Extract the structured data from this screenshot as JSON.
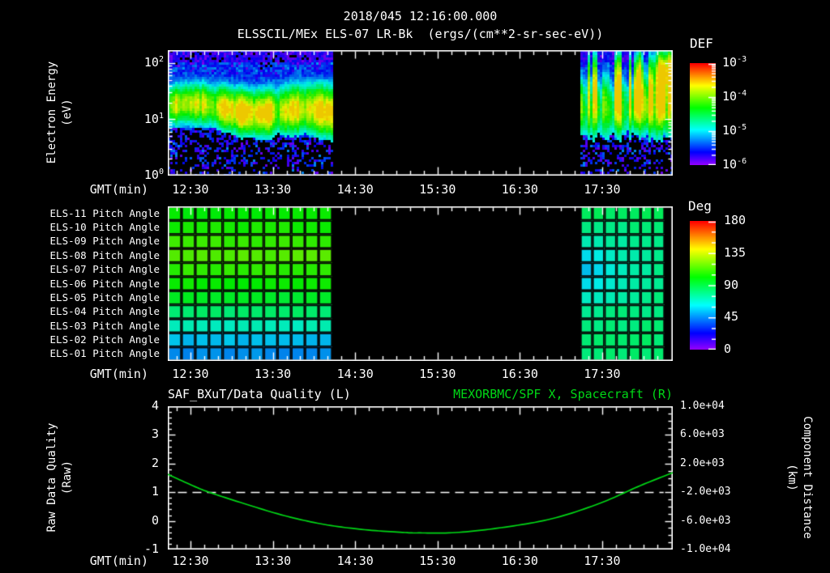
{
  "header": {
    "datetime": "2018/045 12:16:00.000",
    "title": "ELSSCIL/MEx ELS-07 LR-Bk  (ergs/(cm**2-sr-sec-eV))"
  },
  "time_axis": {
    "label": "GMT(min)",
    "tick_labels": [
      "12:30",
      "13:30",
      "14:30",
      "15:30",
      "16:30",
      "17:30"
    ],
    "tick_fracs": [
      0.0449,
      0.208,
      0.3711,
      0.5342,
      0.6972,
      0.8603
    ],
    "minor_frac": 0.02718
  },
  "colors": {
    "background": "#000000",
    "axis": "#ffffff",
    "text": "#ffffff",
    "series_green": "#00d816",
    "quality_dash": "#ffffff"
  },
  "chart_data": [
    {
      "type": "heatmap",
      "name": "electron_energy_spectrogram",
      "title": "ELSSCIL/MEx ELS-07 LR-Bk",
      "units": "ergs/(cm**2-sr-sec-eV)",
      "ylabel": [
        "Electron Energy",
        "(eV)"
      ],
      "yscale": "log",
      "ytick_base": "10",
      "ytick_exponents": [
        "2",
        "1",
        "0"
      ],
      "y_decades_span": 2.23,
      "colorbar": {
        "title": "DEF",
        "scale": "log",
        "tick_base": "10",
        "tick_exponents": [
          "-3",
          "-4",
          "-5",
          "-6"
        ]
      },
      "data_blocks": [
        {
          "start_frac": 0.0,
          "end_frac": 0.326,
          "style": "smooth",
          "band_center_log10_ev": 1.2,
          "band_sigma_decades": 0.34,
          "peak_log10_flux": -4.0
        },
        {
          "start_frac": 0.817,
          "end_frac": 1.0,
          "style": "streaky",
          "band_center_log10_ev": 1.35,
          "band_sigma_decades": 0.45,
          "peak_log10_flux": -3.9
        }
      ],
      "background_log10_flux": -5.7
    },
    {
      "type": "heatmap",
      "name": "pitch_angles",
      "unit": "Deg",
      "colorbar": {
        "title": "Deg",
        "ticks": [
          "180",
          "135",
          "90",
          "45",
          "0"
        ],
        "range": [
          0,
          180
        ]
      },
      "block1": {
        "start_frac": 0.0,
        "end_frac": 0.326,
        "cols": 12
      },
      "block2": {
        "start_frac": 0.817,
        "end_frac": 0.984,
        "cols": 7
      },
      "rows": [
        {
          "label": "ELS-11 Pitch Angle",
          "block1_deg": 102,
          "block2_deg": [
            88,
            87,
            86,
            86,
            87,
            86,
            88
          ]
        },
        {
          "label": "ELS-10 Pitch Angle",
          "block1_deg": 105,
          "block2_deg": [
            82,
            81,
            80,
            80,
            81,
            82,
            83
          ]
        },
        {
          "label": "ELS-09 Pitch Angle",
          "block1_deg": 111,
          "block2_deg": [
            72,
            74,
            75,
            76,
            77,
            78,
            79
          ]
        },
        {
          "label": "ELS-08 Pitch Angle",
          "block1_deg": 115,
          "block2_deg": [
            62,
            66,
            70,
            73,
            75,
            77,
            78
          ]
        },
        {
          "label": "ELS-07 Pitch Angle",
          "block1_deg": 109,
          "block2_deg": [
            56,
            60,
            66,
            71,
            74,
            76,
            78
          ]
        },
        {
          "label": "ELS-06 Pitch Angle",
          "block1_deg": 103,
          "block2_deg": [
            60,
            63,
            68,
            72,
            75,
            77,
            79
          ]
        },
        {
          "label": "ELS-05 Pitch Angle",
          "block1_deg": 95,
          "block2_deg": [
            68,
            70,
            72,
            75,
            77,
            79,
            80
          ]
        },
        {
          "label": "ELS-04 Pitch Angle",
          "block1_deg": 84,
          "block2_deg": [
            78,
            78,
            79,
            80,
            80,
            81,
            81
          ]
        },
        {
          "label": "ELS-03 Pitch Angle",
          "block1_deg": 71,
          "block2_deg": [
            80,
            80,
            81,
            81,
            82,
            82,
            82
          ]
        },
        {
          "label": "ELS-02 Pitch Angle",
          "block1_deg": 55,
          "block2_deg": [
            83,
            83,
            83,
            84,
            84,
            84,
            84
          ]
        },
        {
          "label": "ELS-01 Pitch Angle",
          "block1_deg": 47,
          "block2_deg": [
            82,
            82,
            82,
            83,
            83,
            83,
            83
          ]
        }
      ]
    },
    {
      "type": "line",
      "name": "quality_and_distance",
      "title_left": "SAF_BXuT/Data Quality (L)",
      "title_right": "MEXORBMC/SPF X, Spacecraft (R)",
      "ylabel_left": [
        "Raw Data Quality",
        "(Raw)"
      ],
      "ylabel_right": [
        "Component Distance",
        "(km)"
      ],
      "left_axis": {
        "ticks": [
          "4",
          "3",
          "2",
          "1",
          "0",
          "-1"
        ],
        "range": [
          4,
          -1
        ]
      },
      "right_axis": {
        "ticks": [
          "1.0e+04",
          "6.0e+03",
          "2.0e+03",
          "-2.0e+03",
          "-6.0e+03",
          "-1.0e+04"
        ],
        "range": [
          10000,
          -10000
        ]
      },
      "series": [
        {
          "name": "SAF_BXuT/Data Quality (L)",
          "axis": "left",
          "style": "dashed",
          "color": "#ffffff",
          "constant_value": 1,
          "start_frac": 0.02,
          "end_frac": 0.982
        },
        {
          "name": "MEXORBMC/SPF X, Spacecraft (R)",
          "axis": "right",
          "style": "solid",
          "color": "#00d816",
          "points_frac_km": [
            [
              0,
              500
            ],
            [
              0.05,
              -1100
            ],
            [
              0.082,
              -2000
            ],
            [
              0.15,
              -3560
            ],
            [
              0.23,
              -5250
            ],
            [
              0.31,
              -6500
            ],
            [
              0.39,
              -7230
            ],
            [
              0.47,
              -7630
            ],
            [
              0.5,
              -7680
            ],
            [
              0.57,
              -7630
            ],
            [
              0.66,
              -6950
            ],
            [
              0.76,
              -5710
            ],
            [
              0.855,
              -3560
            ],
            [
              0.936,
              -1070
            ],
            [
              1,
              730
            ]
          ]
        }
      ]
    }
  ]
}
